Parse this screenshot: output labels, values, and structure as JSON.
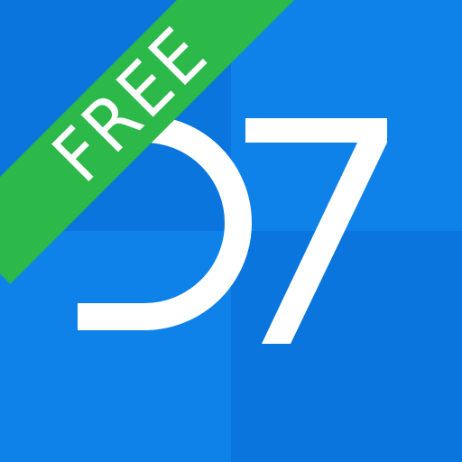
{
  "icon": {
    "glyph_digit": "7",
    "colors": {
      "tile_top_left": "#0a75dc",
      "tile_top_right": "#0f82ea",
      "tile_bottom_left": "#0f82ea",
      "tile_bottom_right": "#0a75dc",
      "glyph": "#ffffff"
    }
  },
  "banner": {
    "label": "FREE",
    "color": "#2db84a",
    "text_color": "#ffffff"
  }
}
